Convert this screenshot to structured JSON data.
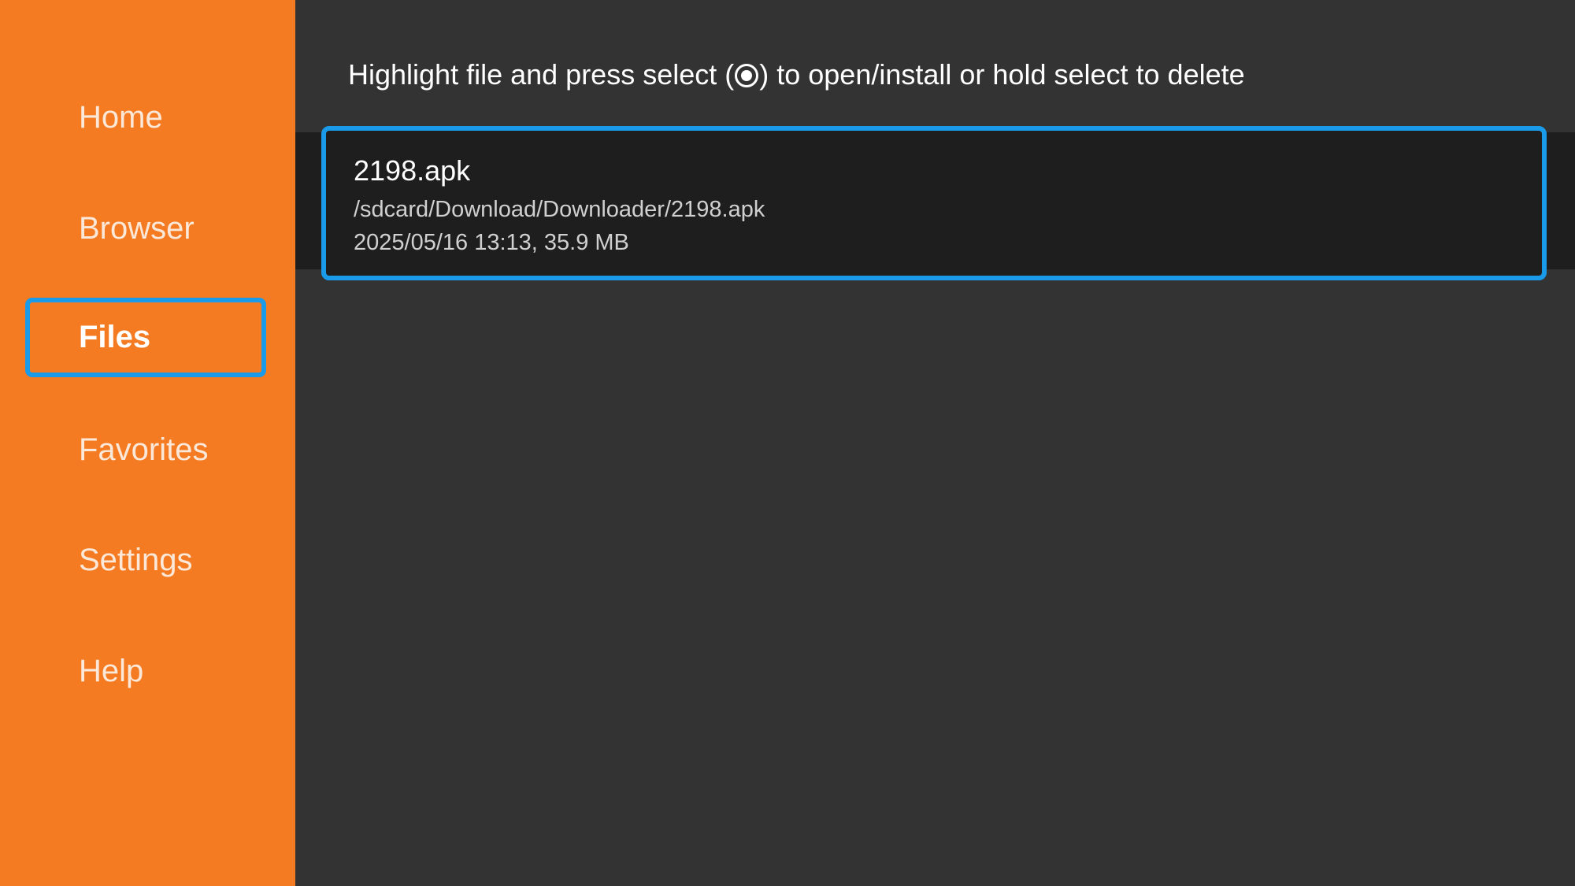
{
  "sidebar": {
    "items": [
      {
        "label": "Home",
        "selected": false
      },
      {
        "label": "Browser",
        "selected": false
      },
      {
        "label": "Files",
        "selected": true
      },
      {
        "label": "Favorites",
        "selected": false
      },
      {
        "label": "Settings",
        "selected": false
      },
      {
        "label": "Help",
        "selected": false
      }
    ]
  },
  "main": {
    "hint_before": "Highlight file and press select (",
    "hint_icon": "select-button-icon",
    "hint_after": ") to open/install or hold select to delete",
    "files": [
      {
        "name": "2198.apk",
        "path": "/sdcard/Download/Downloader/2198.apk",
        "meta": "2025/05/16 13:13, 35.9 MB",
        "selected": true
      }
    ]
  },
  "colors": {
    "accent": "#F47B22",
    "focus": "#1A9BEA",
    "background": "#333333",
    "item_background": "#1E1E1E"
  }
}
